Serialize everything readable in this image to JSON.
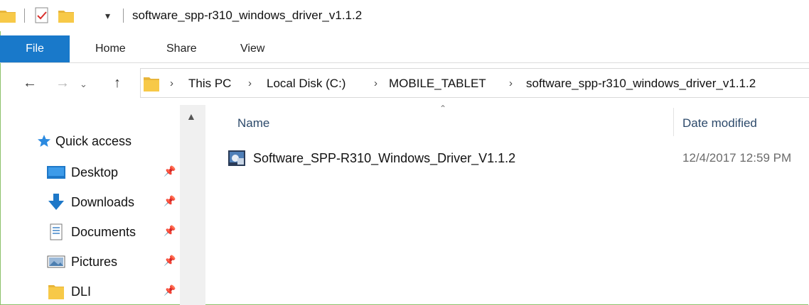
{
  "window": {
    "title": "software_spp-r310_windows_driver_v1.1.2"
  },
  "ribbon": {
    "tabs": [
      "File",
      "Home",
      "Share",
      "View"
    ]
  },
  "navigation": {
    "breadcrumb": [
      "This PC",
      "Local Disk (C:)",
      "MOBILE_TABLET",
      "software_spp-r310_windows_driver_v1.1.2"
    ]
  },
  "sidebar": {
    "quick_access": "Quick access",
    "items": [
      {
        "label": "Desktop",
        "icon": "desktop-icon"
      },
      {
        "label": "Downloads",
        "icon": "downloads-icon"
      },
      {
        "label": "Documents",
        "icon": "documents-icon"
      },
      {
        "label": "Pictures",
        "icon": "pictures-icon"
      },
      {
        "label": "DLI",
        "icon": "folder-icon"
      }
    ]
  },
  "columns": {
    "name": "Name",
    "date_modified": "Date modified"
  },
  "files": [
    {
      "name": "Software_SPP-R310_Windows_Driver_V1.1.2",
      "date": "12/4/2017 12:59 PM",
      "icon": "installer-icon"
    }
  ],
  "colors": {
    "file_tab": "#1979ca",
    "folder": "#f7c948",
    "frame": "#8cc06a"
  }
}
